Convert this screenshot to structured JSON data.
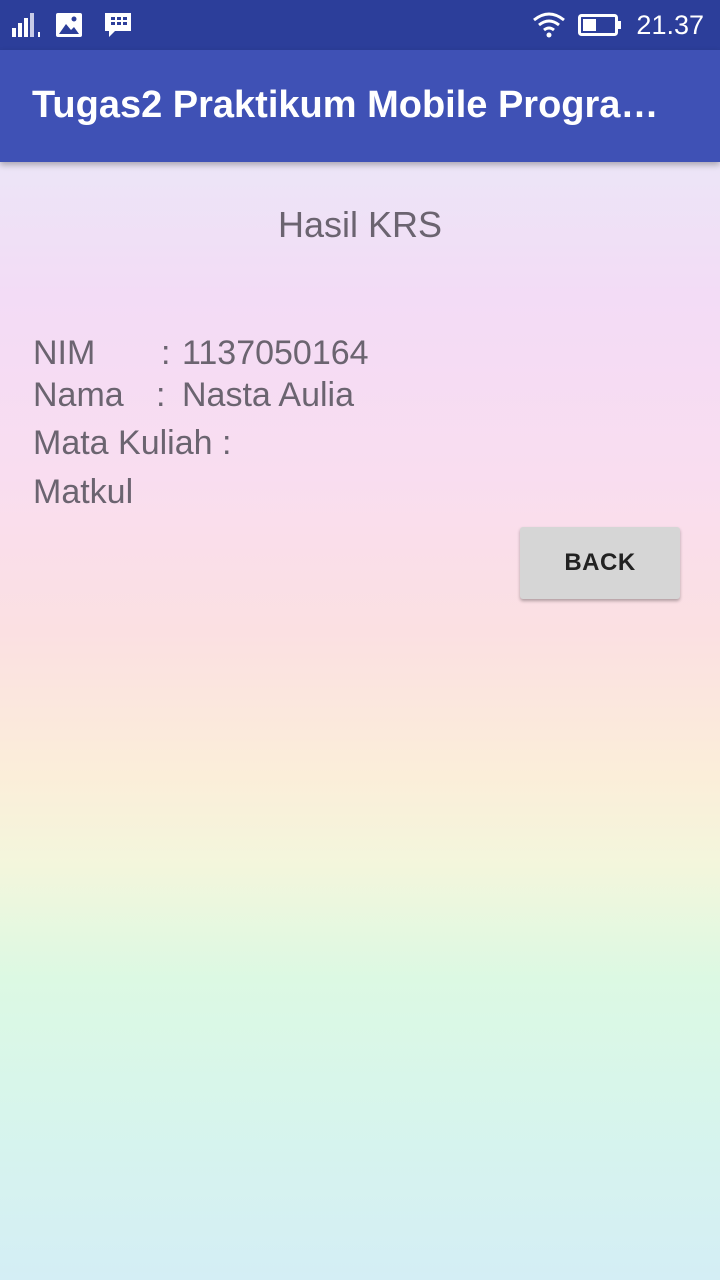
{
  "status_bar": {
    "time": "21.37",
    "icons": [
      "signal-icon",
      "gallery-icon",
      "bbm-icon",
      "wifi-icon",
      "battery-icon"
    ],
    "color": "#2c3e9a"
  },
  "app_bar": {
    "title": "Tugas2 Praktikum Mobile Progra…",
    "color": "#3f51b5"
  },
  "content": {
    "heading": "Hasil KRS",
    "nim_label": "NIM",
    "nim_sep": ":",
    "nim_value": "1137050164",
    "nama_label": "Nama",
    "nama_sep": ":",
    "nama_value": "Nasta Aulia",
    "matkul_label": "Mata Kuliah :",
    "matkul_value": "Matkul",
    "back_label": "BACK",
    "text_color": "#6b6470"
  }
}
